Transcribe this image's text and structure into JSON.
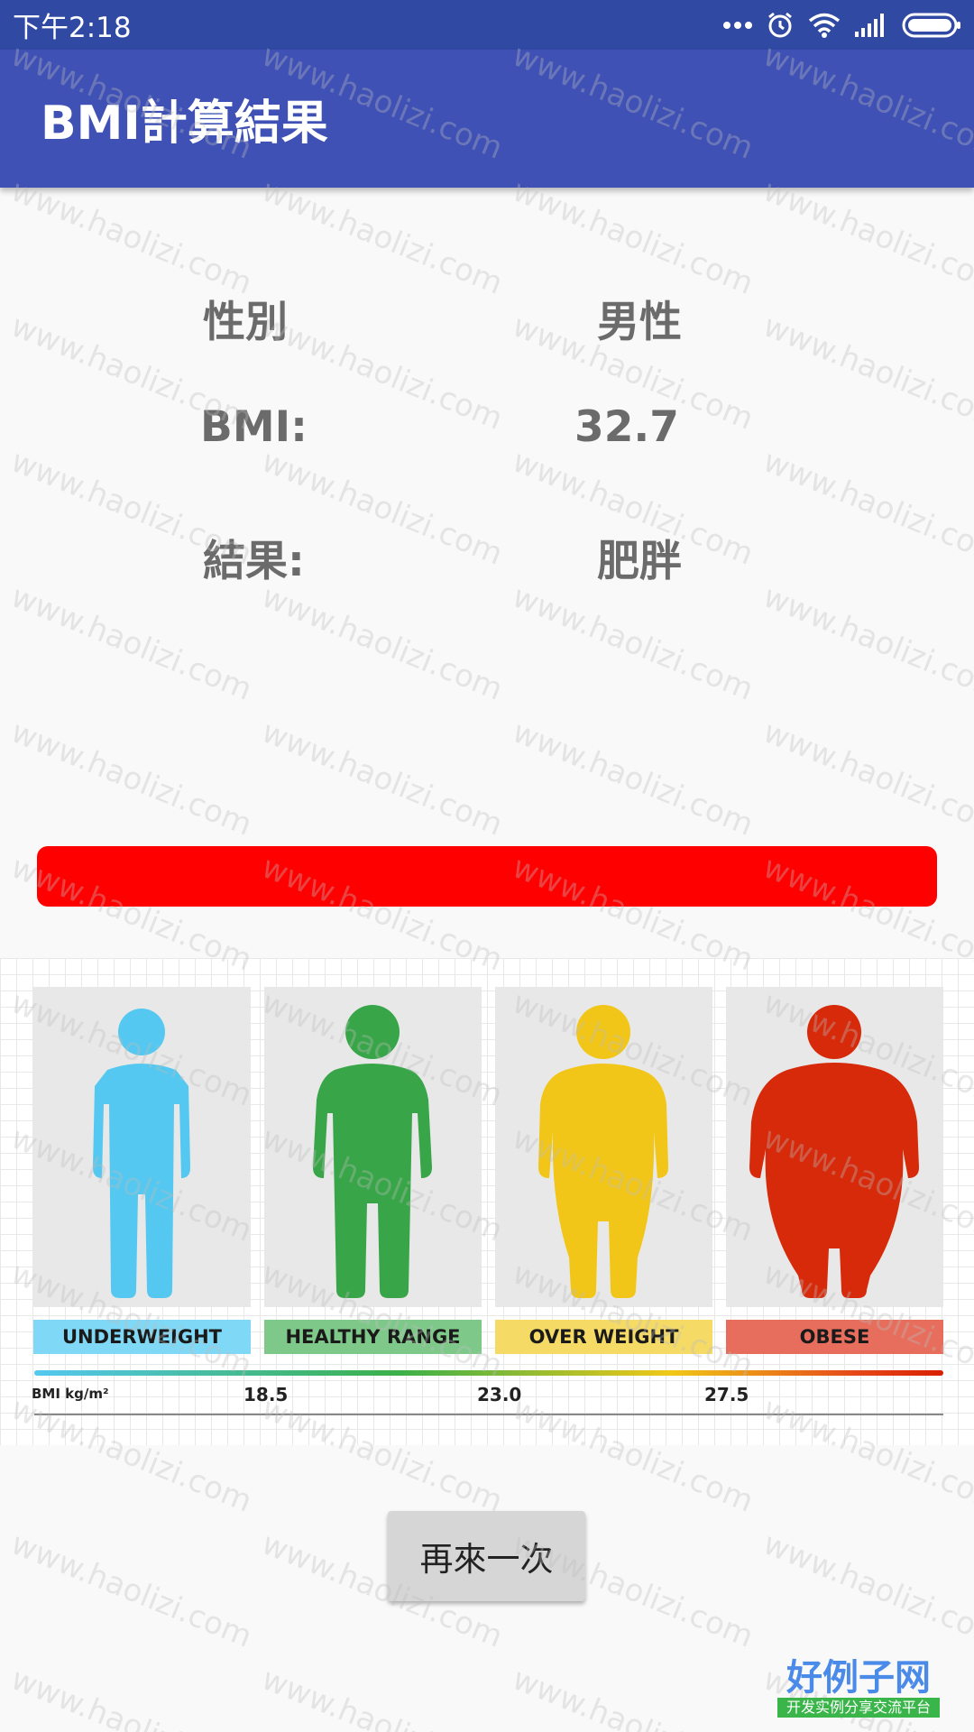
{
  "status_bar": {
    "time": "下午2:18"
  },
  "app_bar": {
    "title": "BMI計算結果"
  },
  "result": {
    "gender_label": "性別",
    "gender_value": "男性",
    "bmi_label": "BMI:",
    "bmi_value": "32.7",
    "result_label": "結果:",
    "result_value": "肥胖",
    "indicator_color": "#ff0000"
  },
  "chart_image": {
    "categories": [
      {
        "label": "UNDERWEIGHT",
        "figure_color": "#54c8f0",
        "label_bg": "#7fd8f5"
      },
      {
        "label": "HEALTHY RANGE",
        "figure_color": "#38a548",
        "label_bg": "#7ec98a"
      },
      {
        "label": "OVER WEIGHT",
        "figure_color": "#f2c618",
        "label_bg": "#f5db66"
      },
      {
        "label": "OBESE",
        "figure_color": "#d62a0a",
        "label_bg": "#e76e5c"
      }
    ],
    "unit": "BMI kg/m²",
    "thresholds": [
      "18.5",
      "23.0",
      "27.5"
    ]
  },
  "again_button": "再來一次",
  "watermark_text": "www.haolizi.com",
  "logo": {
    "main": "好例子网",
    "sub": "开发实例分享交流平台"
  },
  "colors": {
    "primary": "#3f51b5",
    "primary_dark": "#3049a3"
  }
}
